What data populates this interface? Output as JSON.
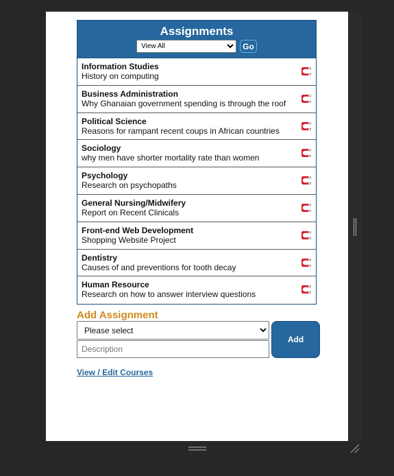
{
  "panel": {
    "title": "Assignments",
    "filter": {
      "selected": "View All",
      "go_label": "Go"
    }
  },
  "assignments": [
    {
      "course": "Information Studies",
      "description": "History on computing"
    },
    {
      "course": "Business Administration",
      "description": "Why Ghanaian government spending is through the roof"
    },
    {
      "course": "Political Science",
      "description": "Reasons for rampant recent coups in African countries"
    },
    {
      "course": "Sociology",
      "description": "why men have shorter mortality rate than women"
    },
    {
      "course": "Psychology",
      "description": "Research on psychopaths"
    },
    {
      "course": "General Nursing/Midwifery",
      "description": "Report on Recent Clinicals"
    },
    {
      "course": "Front-end Web Development",
      "description": "Shopping Website Project"
    },
    {
      "course": "Dentistry",
      "description": "Causes of and preventions for tooth decay"
    },
    {
      "course": "Human Resource",
      "description": "Research on how to answer interview questions"
    }
  ],
  "row_icon": "magnet-icon",
  "add_form": {
    "title": "Add Assignment",
    "course_select_selected": "Please select",
    "description_placeholder": "Description",
    "add_label": "Add"
  },
  "courses_link": "View / Edit Courses",
  "colors": {
    "header_blue": "#25679e",
    "accent_orange": "#d08a1e",
    "magnet_red": "#d9202f"
  }
}
